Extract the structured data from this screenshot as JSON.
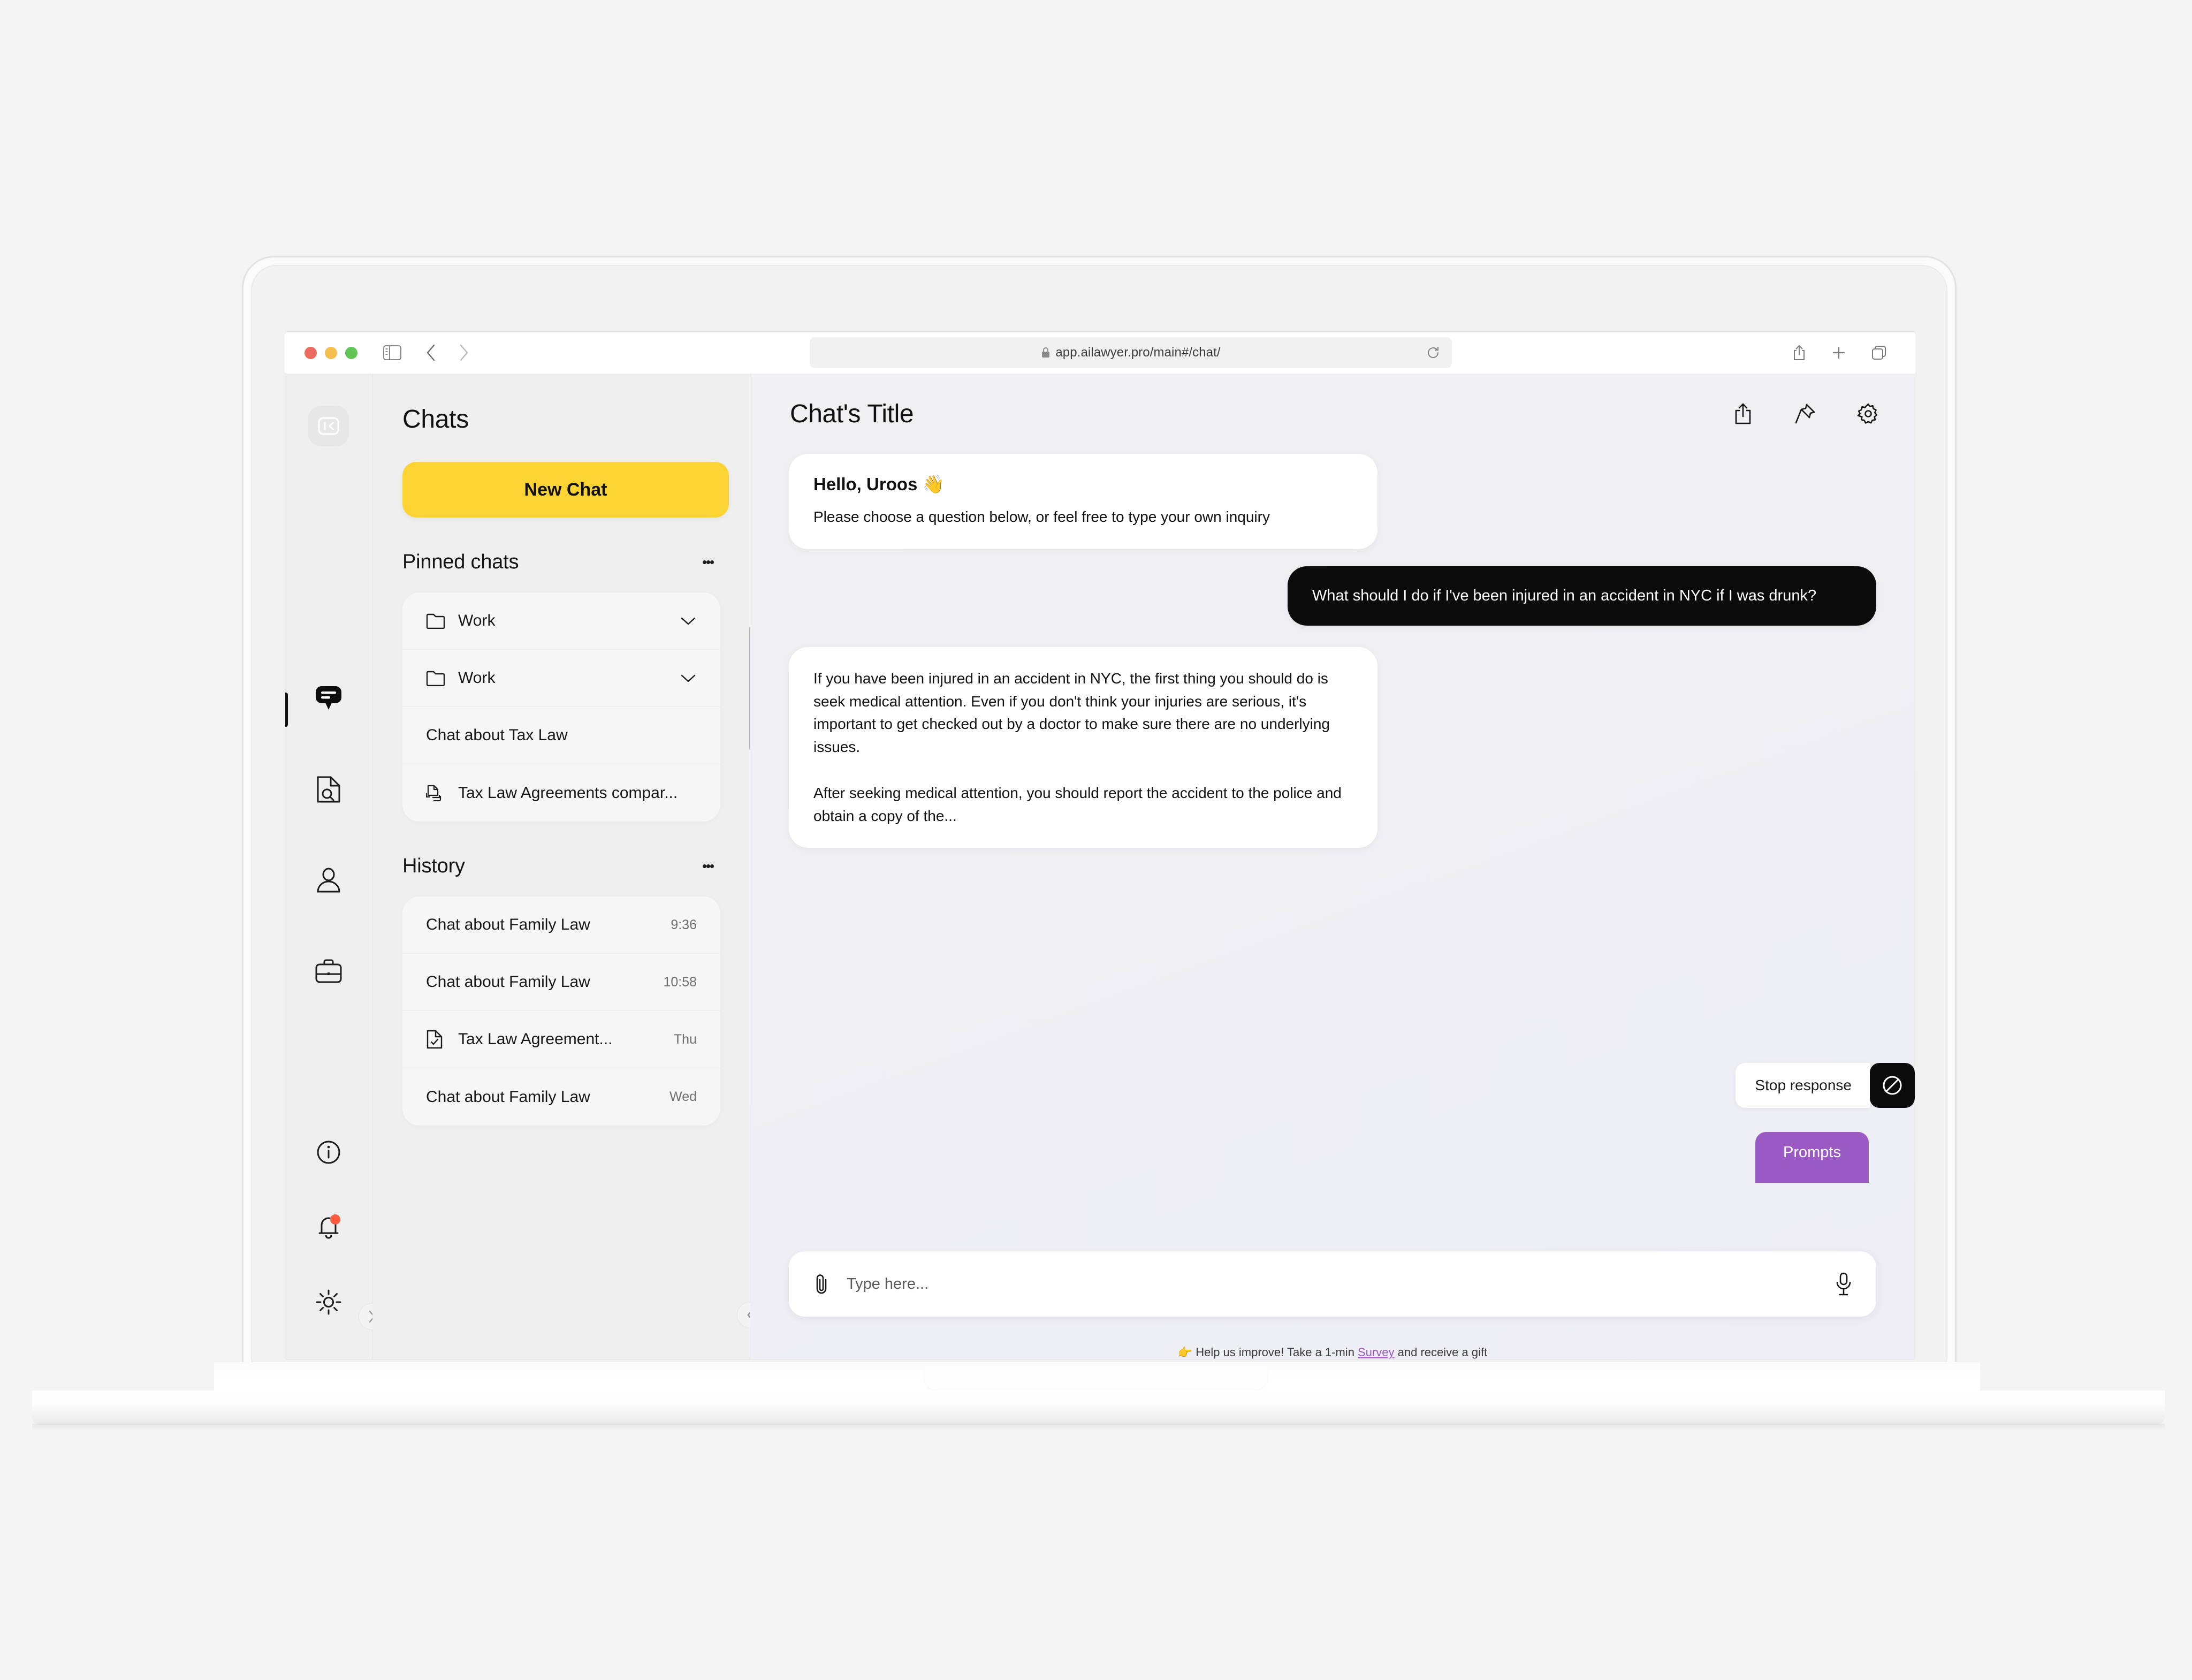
{
  "browser": {
    "url": "app.ailawyer.pro/main#/chat/",
    "lock_icon": "lock-icon",
    "reload_icon": "reload-icon",
    "sidebar_toggle_icon": "sidebar-toggle-icon",
    "back_icon": "chevron-left-icon",
    "forward_icon": "chevron-right-icon",
    "share_icon": "share-icon",
    "new_tab_icon": "plus-icon",
    "tabs_overview_icon": "copy-tabs-icon",
    "traffic_lights": [
      "close-red",
      "minimize-yellow",
      "zoom-green"
    ]
  },
  "rail": {
    "logo_icon": "collapse-panel-icon",
    "items": [
      {
        "name": "chats",
        "icon": "chat-bubble-icon",
        "active": true
      },
      {
        "name": "documents",
        "icon": "document-search-icon",
        "active": false
      },
      {
        "name": "profile",
        "icon": "user-icon",
        "active": false
      },
      {
        "name": "cases",
        "icon": "briefcase-icon",
        "active": false
      }
    ],
    "bottom_items": [
      {
        "name": "info",
        "icon": "info-circle-icon",
        "badge": false
      },
      {
        "name": "notifications",
        "icon": "bell-icon",
        "badge": true
      },
      {
        "name": "theme",
        "icon": "sun-icon",
        "badge": false
      }
    ],
    "expand_icon": "chevron-right-icon"
  },
  "chats_panel": {
    "title": "Chats",
    "new_chat_label": "New Chat",
    "new_chat_color": "#FBD433",
    "pinned": {
      "title": "Pinned chats",
      "menu_icon": "kebab-menu-icon",
      "items": [
        {
          "label": "Work",
          "icon": "folder-icon",
          "trailing_icon": "chevron-down-icon",
          "time": ""
        },
        {
          "label": "Work",
          "icon": "folder-icon",
          "trailing_icon": "chevron-down-icon",
          "time": ""
        },
        {
          "label": "Chat about Tax Law",
          "icon": "",
          "trailing_icon": "",
          "time": ""
        },
        {
          "label": "Tax Law Agreements compar...",
          "icon": "compare-documents-icon",
          "trailing_icon": "",
          "time": ""
        }
      ]
    },
    "history": {
      "title": "History",
      "menu_icon": "kebab-menu-icon",
      "items": [
        {
          "label": "Chat about Family Law",
          "icon": "",
          "time": "9:36"
        },
        {
          "label": "Chat about Family Law",
          "icon": "",
          "time": "10:58"
        },
        {
          "label": "Tax Law Agreement...",
          "icon": "document-check-icon",
          "time": "Thu"
        },
        {
          "label": "Chat about Family Law",
          "icon": "",
          "time": "Wed"
        }
      ]
    },
    "collapse_icon": "chevron-left-icon"
  },
  "chat": {
    "title": "Chat's Title",
    "actions": [
      {
        "name": "share",
        "icon": "share-icon"
      },
      {
        "name": "pin",
        "icon": "pin-icon"
      },
      {
        "name": "settings",
        "icon": "gear-icon"
      }
    ],
    "messages": [
      {
        "role": "assistant",
        "greeting": "Hello, Uroos 👋",
        "text": "Please choose a question below, or feel free to type your own inquiry"
      },
      {
        "role": "user",
        "text": "What should I do if I've been injured in an accident in NYC if I was drunk?"
      },
      {
        "role": "assistant",
        "paragraph1": "If you have been injured in an accident in NYC, the first thing you should do is seek medical attention. Even if you don't think your injuries are serious, it's important to get checked out by a doctor to make sure there are no underlying issues.",
        "paragraph2": "After seeking medical attention, you should report the accident to the police and obtain a copy of the..."
      }
    ],
    "stop_response_label": "Stop response",
    "stop_response_icon": "stop-circle-icon",
    "prompts_label": "Prompts",
    "prompts_color": "#9b59c3",
    "composer": {
      "placeholder": "Type here...",
      "attach_icon": "paperclip-icon",
      "mic_icon": "microphone-icon"
    },
    "footer": {
      "emoji": "👉",
      "text_before": "Help us improve! Take a 1-min ",
      "link": "Survey",
      "text_after": " and receive a gift"
    }
  }
}
